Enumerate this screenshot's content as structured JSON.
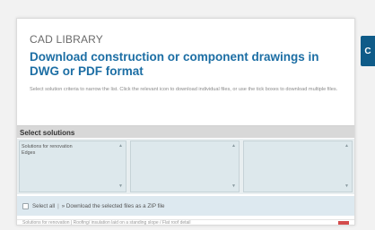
{
  "header": {
    "overline": "CAD LIBRARY",
    "title": "Download construction or component drawings in DWG or PDF format",
    "description": "Select solution criteria to narrow the list. Click the relevant icon to download individual files, or use the tick boxes to download multiple files."
  },
  "side_tab": {
    "label": "C"
  },
  "solutions": {
    "heading": "Select solutions",
    "list1": [
      "Solutions for renovation",
      "Edges"
    ],
    "list2": [],
    "list3": []
  },
  "select_bar": {
    "select_all": "Select all",
    "separator": "|",
    "zip_link": "» Download the selected files as a ZIP file"
  },
  "partial_row": {
    "text": "Solutions for renovation | Roofing/ insulation laid on a standing slope / Flat roof detail"
  },
  "colors": {
    "accent": "#1c6ea4",
    "tab": "#0f5b88"
  }
}
